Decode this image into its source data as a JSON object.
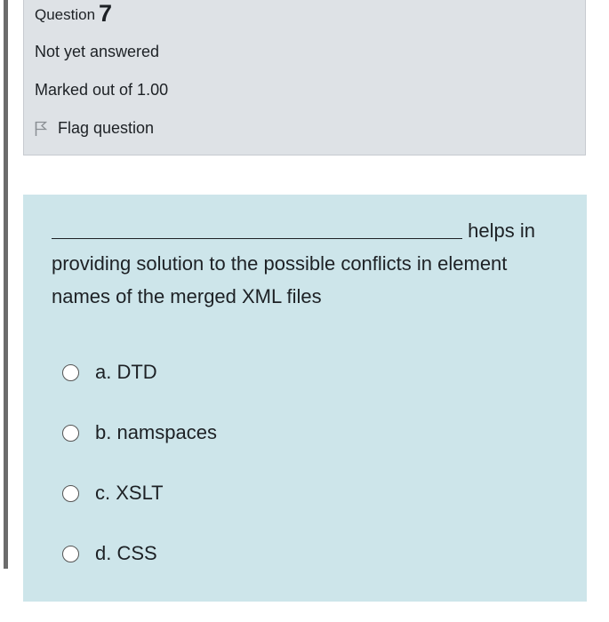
{
  "info": {
    "question_label": "Question",
    "question_number": "7",
    "status": "Not yet answered",
    "marks": "Marked out of 1.00",
    "flag_label": "Flag question"
  },
  "question": {
    "blank": "",
    "text_after_blank": " helps in providing solution to the possible conflicts in element names of the merged XML files",
    "answers": [
      {
        "label": "a. DTD"
      },
      {
        "label": "b. namspaces"
      },
      {
        "label": "c. XSLT"
      },
      {
        "label": "d. CSS"
      }
    ]
  },
  "colors": {
    "info_bg": "#dee2e6",
    "question_bg": "#cde5ea",
    "text": "#1d2125"
  }
}
